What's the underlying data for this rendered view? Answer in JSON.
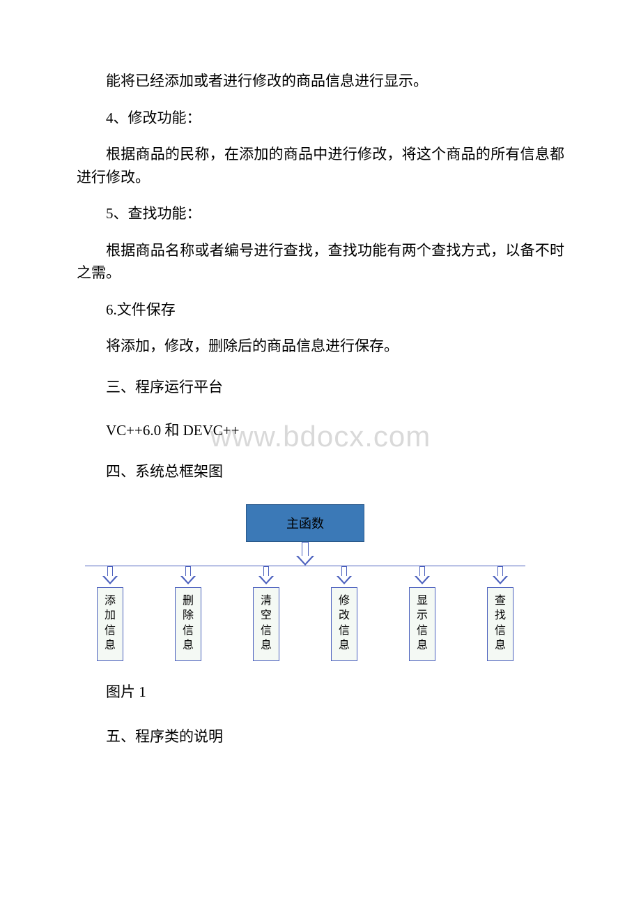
{
  "watermark": "www.bdocx.com",
  "paragraphs": {
    "p1": "能将已经添加或者进行修改的商品信息进行显示。",
    "p2": "4、修改功能：",
    "p3": "根据商品的民称，在添加的商品中进行修改，将这个商品的所有信息都进行修改。",
    "p4": "5、查找功能：",
    "p5": "根据商品名称或者编号进行查找，查找功能有两个查找方式，以备不时之需。",
    "p6": "6.文件保存",
    "p7": "将添加，修改，删除后的商品信息进行保存。",
    "h3": "三、程序运行平台",
    "p8": "VC++6.0 和 DEVC++",
    "h4": "四、系统总框架图",
    "caption": "图片 1",
    "h5": "五、程序类的说明"
  },
  "diagram": {
    "root": "主函数",
    "leaves": [
      [
        "添",
        "加",
        "信",
        "息"
      ],
      [
        "删",
        "除",
        "信",
        "息"
      ],
      [
        "清",
        "空",
        "信",
        "息"
      ],
      [
        "修",
        "改",
        "信",
        "息"
      ],
      [
        "显",
        "示",
        "信",
        "息"
      ],
      [
        "查",
        "找",
        "信",
        "息"
      ]
    ]
  }
}
